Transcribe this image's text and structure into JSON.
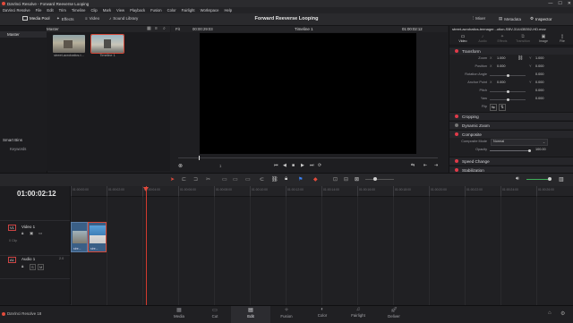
{
  "window": {
    "title": "DaVinci Resolve - Forward Reeverse Looping",
    "controls": [
      "—",
      "☐",
      "✕"
    ]
  },
  "menu": [
    "DaVinci Resolve",
    "File",
    "Edit",
    "Trim",
    "Timeline",
    "Clip",
    "Mark",
    "View",
    "Playback",
    "Fusion",
    "Color",
    "Fairlight",
    "Workspace",
    "Help"
  ],
  "toolbar": {
    "left": [
      "Media Pool",
      "Effects",
      "Video",
      "Sound Library"
    ],
    "project_title": "Forward Reeverse Looping",
    "right": [
      "Mixer",
      "Metadata",
      "Inspector"
    ]
  },
  "media_pool": {
    "bin_header": "Master",
    "sidebar_master": "Master",
    "smart_bins": "Smart Bins",
    "keywords": "Keywords",
    "clips": [
      {
        "label": "street-acrobatics-t..."
      },
      {
        "label": "Timeline 1"
      }
    ]
  },
  "viewer": {
    "fit": "Fit",
    "source_tc": "00:00:29:03",
    "timeline_name": "Timeline 1",
    "record_tc": "01:00:02:12",
    "page_indicator": "1"
  },
  "inspector": {
    "clip_name": "street-acrobatics-teenager...otion-SBV-314435352-HD.mov",
    "tabs": [
      "Video",
      "Audio",
      "Effects",
      "Transition",
      "Image",
      "File"
    ],
    "sections": {
      "transform": "Transform",
      "cropping": "Cropping",
      "dynamic_zoom": "Dynamic Zoom",
      "composite": "Composite",
      "speed_change": "Speed Change",
      "stabilization": "Stabilization"
    },
    "props": {
      "zoom": {
        "label": "Zoom",
        "x_label": "X",
        "x": "1.000",
        "y_label": "Y",
        "y": "1.000"
      },
      "position": {
        "label": "Position",
        "x_label": "X",
        "x": "0.000",
        "y_label": "Y",
        "y": "0.000"
      },
      "rotation": {
        "label": "Rotation Angle",
        "value": "0.000"
      },
      "anchor": {
        "label": "Anchor Point",
        "x_label": "X",
        "x": "0.000",
        "y_label": "Y",
        "y": "0.000"
      },
      "pitch": {
        "label": "Pitch",
        "value": "0.000"
      },
      "yaw": {
        "label": "Yaw",
        "value": "0.000"
      },
      "flip": {
        "label": "Flip"
      },
      "composite_mode": {
        "label": "Composite Mode",
        "value": "Normal"
      },
      "opacity": {
        "label": "Opacity",
        "value": "100.00",
        "fraction": 1.0
      }
    }
  },
  "timeline": {
    "timecode": "01:00:02:12",
    "ruler": [
      "01:00:00:00",
      "01:00:02:00",
      "01:00:04:00",
      "01:00:06:00",
      "01:00:08:00",
      "01:00:10:00",
      "01:00:12:00",
      "01:00:14:00",
      "01:00:16:00",
      "01:00:18:00",
      "01:00:20:00",
      "01:00:22:00",
      "01:00:24:00",
      "01:00:26:00"
    ],
    "video_track": {
      "id": "V1",
      "name": "Video 1",
      "info": "0 Clip"
    },
    "audio_track": {
      "id": "A1",
      "name": "Audio 1",
      "channels": "2.0"
    },
    "clips": [
      {
        "label": "stre..."
      },
      {
        "label": "stre..."
      }
    ]
  },
  "pages": [
    "Media",
    "Cut",
    "Edit",
    "Fusion",
    "Color",
    "Fairlight",
    "Deliver"
  ],
  "active_page": "Edit",
  "brand": "DaVinci Resolve 18",
  "colors": {
    "accent": "#d23a2e",
    "panel": "#1e1e21",
    "highlight": "#e03b4a"
  }
}
